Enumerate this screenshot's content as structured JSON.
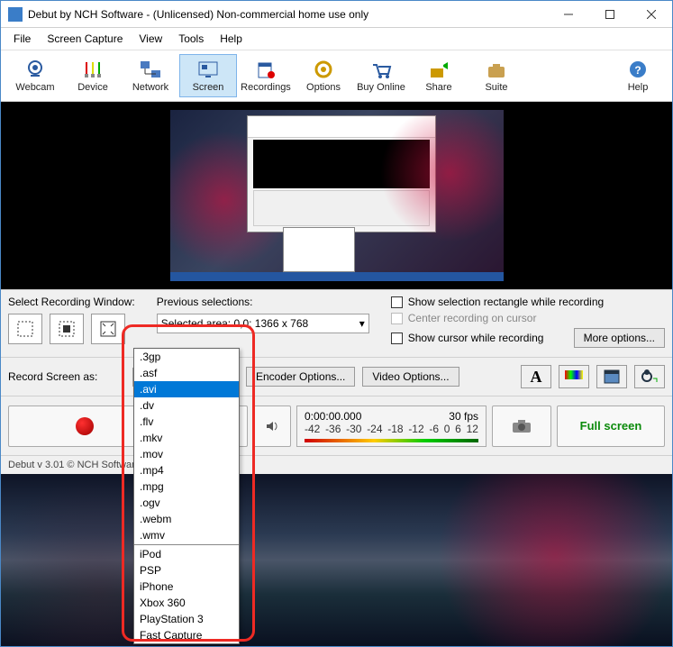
{
  "window": {
    "title": "Debut by NCH Software - (Unlicensed) Non-commercial home use only"
  },
  "menubar": [
    "File",
    "Screen Capture",
    "View",
    "Tools",
    "Help"
  ],
  "toolbar": [
    {
      "id": "webcam",
      "label": "Webcam"
    },
    {
      "id": "device",
      "label": "Device"
    },
    {
      "id": "network",
      "label": "Network"
    },
    {
      "id": "screen",
      "label": "Screen",
      "selected": true
    },
    {
      "id": "recordings",
      "label": "Recordings"
    },
    {
      "id": "options",
      "label": "Options"
    },
    {
      "id": "buyonline",
      "label": "Buy Online"
    },
    {
      "id": "share",
      "label": "Share"
    },
    {
      "id": "suite",
      "label": "Suite"
    },
    {
      "id": "help",
      "label": "Help"
    }
  ],
  "selection": {
    "label": "Select Recording Window:",
    "prev_label": "Previous selections:",
    "prev_value": "Selected area: 0,0; 1366 x 768",
    "chk1": "Show selection rectangle while recording",
    "chk2": "Center recording on cursor",
    "chk3": "Show cursor while recording",
    "more": "More options..."
  },
  "record": {
    "label": "Record Screen as:",
    "current": ".avi",
    "encoder": "Encoder Options...",
    "video": "Video Options...",
    "options": [
      ".3gp",
      ".asf",
      ".avi",
      ".dv",
      ".flv",
      ".mkv",
      ".mov",
      ".mp4",
      ".mpg",
      ".ogv",
      ".webm",
      ".wmv",
      "__sep",
      "iPod",
      "PSP",
      "iPhone",
      "Xbox 360",
      "PlayStation 3",
      "Fast Capture"
    ],
    "selected_index": 2
  },
  "ctrl": {
    "time": "0:00:00.000",
    "fps": "30 fps",
    "ticks": [
      "-42",
      "-36",
      "-30",
      "-24",
      "-18",
      "-12",
      "-6",
      "0",
      "6",
      "12"
    ],
    "full": "Full screen"
  },
  "footer": "Debut v 3.01 © NCH Software"
}
